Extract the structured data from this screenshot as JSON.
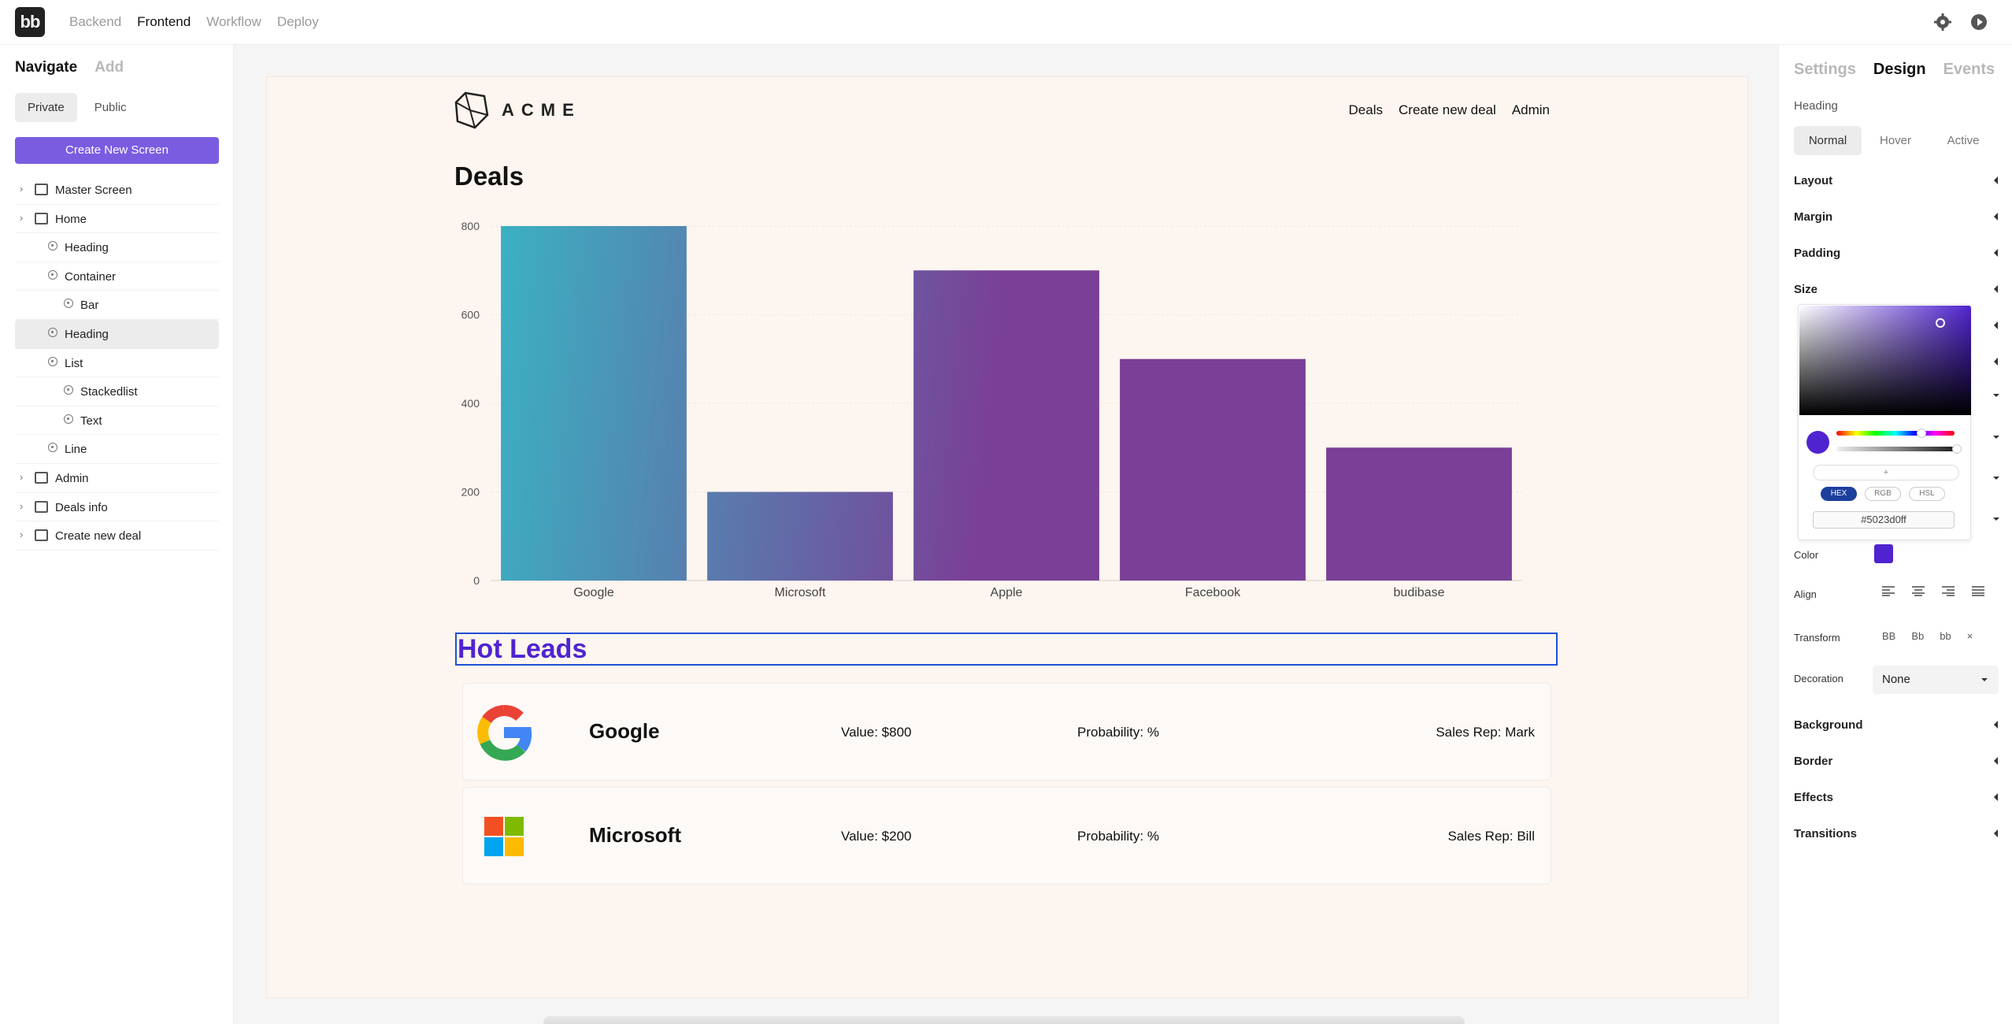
{
  "topbar": {
    "logo": "bb",
    "tabs": [
      {
        "label": "Backend",
        "active": false
      },
      {
        "label": "Frontend",
        "active": true
      },
      {
        "label": "Workflow",
        "active": false
      },
      {
        "label": "Deploy",
        "active": false
      }
    ],
    "icons": [
      "gear-icon",
      "play-icon"
    ]
  },
  "sidebar": {
    "tabs": [
      {
        "label": "Navigate",
        "active": true
      },
      {
        "label": "Add",
        "active": false
      }
    ],
    "access": [
      {
        "label": "Private",
        "selected": true
      },
      {
        "label": "Public",
        "selected": false
      }
    ],
    "create_button": "Create New Screen",
    "tree": [
      {
        "label": "Master Screen",
        "type": "layout",
        "depth": 0,
        "expandable": true
      },
      {
        "label": "Home",
        "type": "screen",
        "depth": 0,
        "expandable": true
      },
      {
        "label": "Heading",
        "type": "component",
        "depth": 1
      },
      {
        "label": "Container",
        "type": "component",
        "depth": 1
      },
      {
        "label": "Bar",
        "type": "component",
        "depth": 2
      },
      {
        "label": "Heading",
        "type": "component",
        "depth": 1,
        "selected": true
      },
      {
        "label": "List",
        "type": "component",
        "depth": 1
      },
      {
        "label": "Stackedlist",
        "type": "component",
        "depth": 2
      },
      {
        "label": "Text",
        "type": "component",
        "depth": 2
      },
      {
        "label": "Line",
        "type": "component",
        "depth": 1
      },
      {
        "label": "Admin",
        "type": "screen",
        "depth": 0,
        "expandable": true
      },
      {
        "label": "Deals info",
        "type": "screen",
        "depth": 0,
        "expandable": true
      },
      {
        "label": "Create new deal",
        "type": "screen",
        "depth": 0,
        "expandable": true
      }
    ]
  },
  "app": {
    "brand": "ACME",
    "nav": [
      "Deals",
      "Create new deal",
      "Admin"
    ],
    "page_title": "Deals",
    "selected_heading": "Hot Leads",
    "leads": [
      {
        "name": "Google",
        "value": "Value: $800",
        "probability": "Probability: %",
        "rep": "Sales Rep: Mark",
        "logo": "google-logo"
      },
      {
        "name": "Microsoft",
        "value": "Value: $200",
        "probability": "Probability: %",
        "rep": "Sales Rep: Bill",
        "logo": "microsoft-logo"
      }
    ]
  },
  "chart_data": {
    "type": "bar",
    "categories": [
      "Google",
      "Microsoft",
      "Apple",
      "Facebook",
      "budibase"
    ],
    "values": [
      800,
      200,
      700,
      500,
      300
    ],
    "ylim": [
      0,
      800
    ],
    "yticks": [
      "0",
      "200",
      "400",
      "600",
      "800"
    ],
    "title": "",
    "xlabel": "",
    "ylabel": "",
    "grid": true,
    "colors": {
      "start": "#3ab3c3",
      "end": "#7a3f96"
    }
  },
  "design_panel": {
    "tabs": [
      {
        "label": "Settings",
        "active": false
      },
      {
        "label": "Design",
        "active": true
      },
      {
        "label": "Events",
        "active": false
      }
    ],
    "component_name": "Heading",
    "states": [
      {
        "label": "Normal",
        "selected": true
      },
      {
        "label": "Hover",
        "selected": false
      },
      {
        "label": "Active",
        "selected": false
      }
    ],
    "sections_top": [
      "Layout",
      "Margin",
      "Padding",
      "Size"
    ],
    "color_label": "Color",
    "align_label": "Align",
    "transform_label": "Transform",
    "transform_options": [
      "BB",
      "Bb",
      "bb",
      "×"
    ],
    "decoration_label": "Decoration",
    "decoration_value": "None",
    "sections_bottom": [
      "Background",
      "Border",
      "Effects",
      "Transitions"
    ],
    "color_value": "#5023d0"
  },
  "color_picker": {
    "swatch_add": "+",
    "modes": [
      {
        "label": "HEX",
        "selected": true
      },
      {
        "label": "RGB",
        "selected": false
      },
      {
        "label": "HSL",
        "selected": false
      }
    ],
    "hex_value": "#5023d0ff"
  }
}
